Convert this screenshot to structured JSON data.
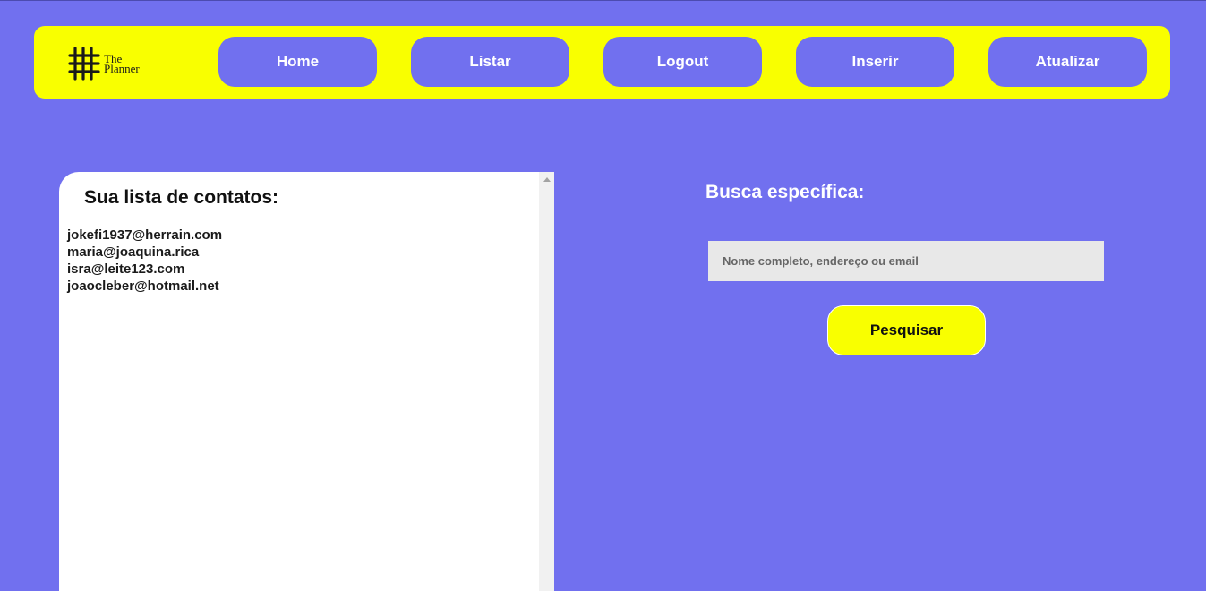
{
  "colors": {
    "background": "#7170ef",
    "accent": "#f9ff00",
    "panel": "#ffffff",
    "input_bg": "#e8e8e8"
  },
  "header": {
    "logo": {
      "icon": "hash-grid-icon",
      "line1": "The",
      "line2": "Planner"
    },
    "nav": [
      {
        "label": "Home"
      },
      {
        "label": "Listar"
      },
      {
        "label": "Logout"
      },
      {
        "label": "Inserir"
      },
      {
        "label": "Atualizar"
      }
    ]
  },
  "contacts": {
    "title": "Sua lista de contatos:",
    "items": [
      "jokefi1937@herrain.com",
      "maria@joaquina.rica",
      "isra@leite123.com",
      "joaocleber@hotmail.net"
    ]
  },
  "search": {
    "title": "Busca específica:",
    "value": "",
    "placeholder": "Nome completo, endereço ou email",
    "button_label": "Pesquisar"
  }
}
